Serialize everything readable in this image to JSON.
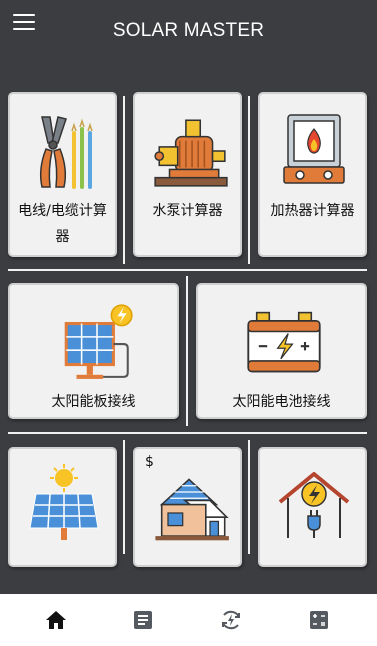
{
  "header": {
    "title": "SOLAR MASTER",
    "menu_icon": "hamburger-menu-icon"
  },
  "calculators": [
    {
      "label": "电线/电缆计算器",
      "icon": "wire-cutter-cables-icon"
    },
    {
      "label": "水泵计算器",
      "icon": "water-pump-icon"
    },
    {
      "label": "加热器计算器",
      "icon": "heater-icon"
    }
  ],
  "wiring": [
    {
      "label": "太阳能板接线",
      "icon": "solar-panel-wiring-icon"
    },
    {
      "label": "太阳能电池接线",
      "icon": "battery-wiring-icon"
    }
  ],
  "more": [
    {
      "label": "",
      "icon": "solar-panel-sun-icon"
    },
    {
      "label": "$",
      "icon": "solar-house-icon"
    },
    {
      "label": "",
      "icon": "home-energy-icon"
    }
  ],
  "bottom_nav": [
    {
      "icon": "home-icon"
    },
    {
      "icon": "article-icon"
    },
    {
      "icon": "energy-cycle-icon"
    },
    {
      "icon": "calculator-icon"
    }
  ],
  "colors": {
    "background": "#3b3d41",
    "card": "#f1f1f1",
    "accent_orange": "#e07b39",
    "solar_blue": "#4a90d9",
    "bolt_yellow": "#f7c325"
  }
}
